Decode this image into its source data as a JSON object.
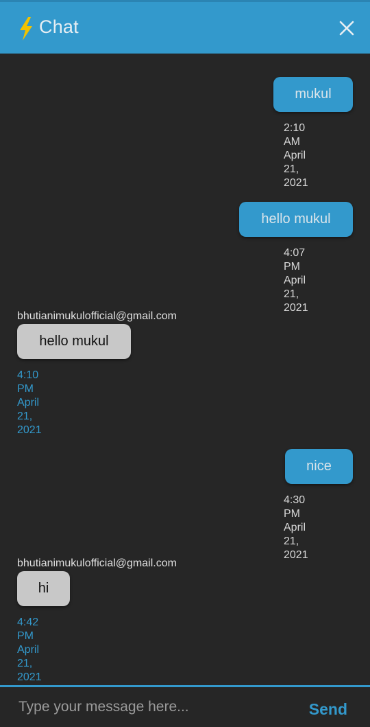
{
  "header": {
    "title": "Chat",
    "logo_icon": "lightning-bolt-icon",
    "close_icon": "close-icon"
  },
  "colors": {
    "accent": "#3399cc",
    "background": "#262626",
    "incoming_bubble": "#c8c8c8",
    "bolt": "#f2c200"
  },
  "messages": [
    {
      "direction": "out",
      "text": "mukul",
      "time": "2:10 AM",
      "date": "April 21, 2021"
    },
    {
      "direction": "out",
      "text": "hello mukul",
      "time": "4:07 PM",
      "date": "April 21, 2021"
    },
    {
      "direction": "in",
      "sender": "bhutianimukulofficial@gmail.com",
      "text": "hello mukul",
      "time": "4:10 PM",
      "date": "April 21, 2021"
    },
    {
      "direction": "out",
      "text": "nice",
      "time": "4:30 PM",
      "date": "April 21, 2021"
    },
    {
      "direction": "in",
      "sender": "bhutianimukulofficial@gmail.com",
      "text": "hi",
      "time": "4:42 PM",
      "date": "April 21, 2021"
    }
  ],
  "composer": {
    "placeholder": "Type your message here...",
    "value": "",
    "send_label": "Send"
  }
}
